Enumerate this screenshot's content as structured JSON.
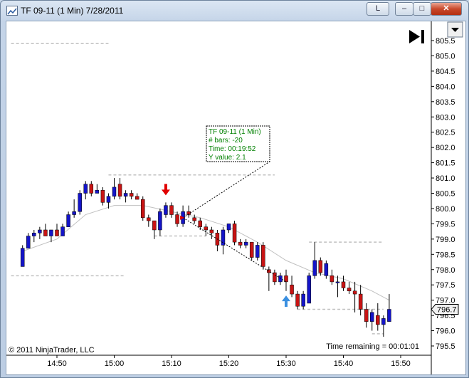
{
  "window": {
    "title": "TF 09-11 (1 Min)  7/28/2011",
    "buttons": {
      "link": "L",
      "minimize": "–",
      "maximize": "□",
      "close": "✕"
    },
    "icon": "chart-window-icon"
  },
  "chart": {
    "copyright": "© 2011 NinjaTrader, LLC",
    "time_remaining": "Time remaining = 00:01:01",
    "current_price_label": "796.7",
    "icons": {
      "scroll_end": "skip-to-end-icon",
      "menu": "dropdown-arrow-icon",
      "down_marker": "down-arrow-icon",
      "up_marker": "up-arrow-icon"
    },
    "colors": {
      "up_bar": "#1414c8",
      "down_bar": "#c81414",
      "tooltip_text": "#008000",
      "sma": "#c0c0c0",
      "level_line": "#c0c0c0",
      "down_marker": "#e00000",
      "up_marker": "#3a8fe0"
    },
    "tooltip": {
      "lines": [
        "TF 09-11 (1 Min)",
        "# bars:   -20",
        "Time:     00:19:52",
        "Y value: 2.1"
      ]
    }
  },
  "chart_data": {
    "type": "candlestick",
    "title": "TF 09-11 (1 Min)  7/28/2011",
    "xlabel": "",
    "ylabel": "",
    "ylim": [
      795.3,
      805.8
    ],
    "y_ticks": [
      "795.5",
      "796.0",
      "796.5",
      "797.0",
      "797.5",
      "798.0",
      "798.5",
      "799.0",
      "799.5",
      "800.0",
      "800.5",
      "801.0",
      "801.5",
      "802.0",
      "802.5",
      "803.0",
      "803.5",
      "804.0",
      "804.5",
      "805.0",
      "805.5"
    ],
    "x_ticks": [
      "14:50",
      "15:00",
      "15:10",
      "15:20",
      "15:30",
      "15:40",
      "15:50"
    ],
    "x_tick_minutes": [
      0,
      10,
      20,
      30,
      40,
      50,
      60
    ],
    "bars": [
      {
        "t": -6,
        "o": 798.1,
        "h": 798.8,
        "l": 798.1,
        "c": 798.7
      },
      {
        "t": -5,
        "o": 798.7,
        "h": 799.2,
        "l": 798.7,
        "c": 799.1
      },
      {
        "t": -4,
        "o": 799.1,
        "h": 799.3,
        "l": 798.9,
        "c": 799.2
      },
      {
        "t": -3,
        "o": 799.2,
        "h": 799.4,
        "l": 799.0,
        "c": 799.3
      },
      {
        "t": -2,
        "o": 799.3,
        "h": 799.5,
        "l": 799.1,
        "c": 799.1
      },
      {
        "t": -1,
        "o": 799.1,
        "h": 799.3,
        "l": 798.9,
        "c": 799.3
      },
      {
        "t": 0,
        "o": 799.3,
        "h": 799.5,
        "l": 799.1,
        "c": 799.1
      },
      {
        "t": 1,
        "o": 799.1,
        "h": 799.5,
        "l": 799.1,
        "c": 799.4
      },
      {
        "t": 2,
        "o": 799.4,
        "h": 799.9,
        "l": 799.4,
        "c": 799.8
      },
      {
        "t": 3,
        "o": 799.8,
        "h": 800.3,
        "l": 799.7,
        "c": 799.9
      },
      {
        "t": 4,
        "o": 799.9,
        "h": 800.6,
        "l": 799.8,
        "c": 800.5
      },
      {
        "t": 5,
        "o": 800.5,
        "h": 800.9,
        "l": 800.3,
        "c": 800.8
      },
      {
        "t": 6,
        "o": 800.8,
        "h": 800.9,
        "l": 800.4,
        "c": 800.5
      },
      {
        "t": 7,
        "o": 800.5,
        "h": 800.8,
        "l": 800.5,
        "c": 800.6
      },
      {
        "t": 8,
        "o": 800.6,
        "h": 800.7,
        "l": 800.1,
        "c": 800.2
      },
      {
        "t": 9,
        "o": 800.2,
        "h": 800.5,
        "l": 800.0,
        "c": 800.4
      },
      {
        "t": 10,
        "o": 800.4,
        "h": 801.0,
        "l": 800.3,
        "c": 800.7
      },
      {
        "t": 11,
        "o": 800.8,
        "h": 801.0,
        "l": 800.3,
        "c": 800.4
      },
      {
        "t": 12,
        "o": 800.4,
        "h": 800.6,
        "l": 800.2,
        "c": 800.5
      },
      {
        "t": 13,
        "o": 800.5,
        "h": 800.6,
        "l": 800.3,
        "c": 800.4
      },
      {
        "t": 14,
        "o": 800.4,
        "h": 800.5,
        "l": 800.3,
        "c": 800.3
      },
      {
        "t": 15,
        "o": 800.3,
        "h": 800.4,
        "l": 799.6,
        "c": 799.7
      },
      {
        "t": 16,
        "o": 799.7,
        "h": 799.8,
        "l": 799.4,
        "c": 799.6
      },
      {
        "t": 17,
        "o": 799.6,
        "h": 799.6,
        "l": 799.0,
        "c": 799.3
      },
      {
        "t": 18,
        "o": 799.3,
        "h": 800.0,
        "l": 799.1,
        "c": 799.9
      },
      {
        "t": 19,
        "o": 799.8,
        "h": 800.2,
        "l": 799.7,
        "c": 800.1
      },
      {
        "t": 20,
        "o": 800.1,
        "h": 800.2,
        "l": 799.7,
        "c": 799.8
      },
      {
        "t": 21,
        "o": 799.8,
        "h": 799.9,
        "l": 799.4,
        "c": 799.5
      },
      {
        "t": 22,
        "o": 799.5,
        "h": 800.1,
        "l": 799.4,
        "c": 799.9
      },
      {
        "t": 23,
        "o": 799.9,
        "h": 800.1,
        "l": 799.7,
        "c": 799.8
      },
      {
        "t": 24,
        "o": 799.7,
        "h": 799.8,
        "l": 799.5,
        "c": 799.6
      },
      {
        "t": 25,
        "o": 799.6,
        "h": 799.7,
        "l": 799.3,
        "c": 799.4
      },
      {
        "t": 26,
        "o": 799.4,
        "h": 799.5,
        "l": 799.1,
        "c": 799.3
      },
      {
        "t": 27,
        "o": 799.3,
        "h": 799.4,
        "l": 799.0,
        "c": 799.2
      },
      {
        "t": 28,
        "o": 799.2,
        "h": 799.3,
        "l": 798.6,
        "c": 798.8
      },
      {
        "t": 29,
        "o": 798.8,
        "h": 799.4,
        "l": 798.5,
        "c": 799.3
      },
      {
        "t": 30,
        "o": 799.3,
        "h": 799.5,
        "l": 799.2,
        "c": 799.5
      },
      {
        "t": 31,
        "o": 799.5,
        "h": 799.6,
        "l": 798.8,
        "c": 798.9
      },
      {
        "t": 32,
        "o": 798.9,
        "h": 799.0,
        "l": 798.7,
        "c": 798.8
      },
      {
        "t": 33,
        "o": 798.8,
        "h": 799.0,
        "l": 798.7,
        "c": 798.9
      },
      {
        "t": 34,
        "o": 798.9,
        "h": 798.9,
        "l": 798.3,
        "c": 798.4
      },
      {
        "t": 35,
        "o": 798.4,
        "h": 798.9,
        "l": 798.3,
        "c": 798.8
      },
      {
        "t": 36,
        "o": 798.8,
        "h": 798.9,
        "l": 798.0,
        "c": 798.1
      },
      {
        "t": 37,
        "o": 798.0,
        "h": 798.1,
        "l": 797.3,
        "c": 797.9
      },
      {
        "t": 38,
        "o": 797.9,
        "h": 798.0,
        "l": 797.5,
        "c": 797.6
      },
      {
        "t": 39,
        "o": 797.6,
        "h": 797.9,
        "l": 797.5,
        "c": 797.8
      },
      {
        "t": 40,
        "o": 797.8,
        "h": 798.0,
        "l": 797.3,
        "c": 797.6
      },
      {
        "t": 41,
        "o": 797.5,
        "h": 797.8,
        "l": 797.1,
        "c": 797.2
      },
      {
        "t": 42,
        "o": 797.2,
        "h": 797.3,
        "l": 796.7,
        "c": 796.8
      },
      {
        "t": 43,
        "o": 796.8,
        "h": 797.3,
        "l": 796.7,
        "c": 797.2
      },
      {
        "t": 44,
        "o": 796.9,
        "h": 797.9,
        "l": 796.9,
        "c": 797.8
      },
      {
        "t": 45,
        "o": 797.8,
        "h": 798.9,
        "l": 797.7,
        "c": 798.3
      },
      {
        "t": 46,
        "o": 798.3,
        "h": 798.4,
        "l": 797.8,
        "c": 797.9
      },
      {
        "t": 47,
        "o": 797.8,
        "h": 798.3,
        "l": 797.7,
        "c": 798.2
      },
      {
        "t": 48,
        "o": 797.8,
        "h": 798.0,
        "l": 797.5,
        "c": 797.6
      },
      {
        "t": 49,
        "o": 797.6,
        "h": 797.8,
        "l": 797.1,
        "c": 797.6
      },
      {
        "t": 50,
        "o": 797.6,
        "h": 797.8,
        "l": 797.3,
        "c": 797.4
      },
      {
        "t": 51,
        "o": 797.4,
        "h": 797.6,
        "l": 797.2,
        "c": 797.3
      },
      {
        "t": 52,
        "o": 797.3,
        "h": 797.6,
        "l": 796.6,
        "c": 797.2
      },
      {
        "t": 53,
        "o": 797.2,
        "h": 797.5,
        "l": 796.5,
        "c": 796.7
      },
      {
        "t": 54,
        "o": 796.7,
        "h": 796.9,
        "l": 796.1,
        "c": 796.3
      },
      {
        "t": 55,
        "o": 796.3,
        "h": 796.7,
        "l": 796.0,
        "c": 796.6
      },
      {
        "t": 56,
        "o": 796.5,
        "h": 796.9,
        "l": 796.0,
        "c": 796.2
      },
      {
        "t": 57,
        "o": 796.2,
        "h": 796.5,
        "l": 795.8,
        "c": 796.4
      },
      {
        "t": 58,
        "o": 796.3,
        "h": 797.2,
        "l": 796.3,
        "c": 796.7
      }
    ],
    "sma": [
      {
        "t": -6,
        "v": 798.6
      },
      {
        "t": 0,
        "v": 799.0
      },
      {
        "t": 5,
        "v": 799.8
      },
      {
        "t": 10,
        "v": 800.1
      },
      {
        "t": 15,
        "v": 800.1
      },
      {
        "t": 20,
        "v": 799.9
      },
      {
        "t": 25,
        "v": 799.7
      },
      {
        "t": 30,
        "v": 799.4
      },
      {
        "t": 35,
        "v": 798.9
      },
      {
        "t": 40,
        "v": 798.3
      },
      {
        "t": 45,
        "v": 797.9
      },
      {
        "t": 50,
        "v": 797.7
      },
      {
        "t": 55,
        "v": 797.3
      },
      {
        "t": 58,
        "v": 797.0
      }
    ],
    "level_lines": [
      {
        "y": 805.4,
        "t1": -8,
        "t2": 9
      },
      {
        "y": 801.1,
        "t1": 9,
        "t2": 38
      },
      {
        "y": 797.8,
        "t1": -8,
        "t2": 12
      },
      {
        "y": 799.1,
        "t1": 17,
        "t2": 26
      },
      {
        "y": 798.9,
        "t1": 44,
        "t2": 57
      },
      {
        "y": 796.7,
        "t1": 42,
        "t2": 57
      },
      {
        "y": 795.9,
        "t1": 55,
        "t2": 57
      }
    ],
    "measure_line": {
      "t1": 22,
      "y1": 799.7,
      "t2": 40,
      "y2": 797.6
    },
    "markers": {
      "down": {
        "t": 19,
        "y": 800.2
      },
      "up": {
        "t": 40,
        "y": 797.2
      }
    }
  }
}
